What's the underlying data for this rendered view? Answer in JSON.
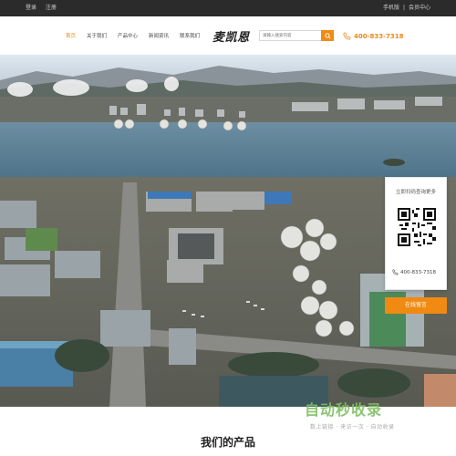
{
  "topbar": {
    "login": "登录",
    "register": "注册",
    "mobile": "手机版",
    "separator": "|",
    "member": "会员中心"
  },
  "nav": {
    "items": [
      {
        "label": "首页",
        "active": true
      },
      {
        "label": "关于我们",
        "active": false
      },
      {
        "label": "产品中心",
        "active": false
      },
      {
        "label": "新闻资讯",
        "active": false
      },
      {
        "label": "联系我们",
        "active": false
      }
    ]
  },
  "brand": {
    "logo_text": "麦凯恩"
  },
  "search": {
    "placeholder": "请输入搜索内容",
    "icon": "search-icon"
  },
  "contact": {
    "phone": "400-833-7318",
    "icon": "phone-icon"
  },
  "banner": {
    "description_icon": "industrial-port-photo"
  },
  "qr_card": {
    "caption": "立即扫码查询更多",
    "phone": "400-833-7318",
    "consult_label": "在线留言"
  },
  "watermark": {
    "title": "自动秒收录",
    "subtitle": "数上链接 · 来访一次 · 自动收录"
  },
  "section": {
    "title": "我们的产品"
  },
  "colors": {
    "accent": "#f08a12",
    "topbar": "#2b2b2b",
    "watermark": "#7fbf62"
  }
}
